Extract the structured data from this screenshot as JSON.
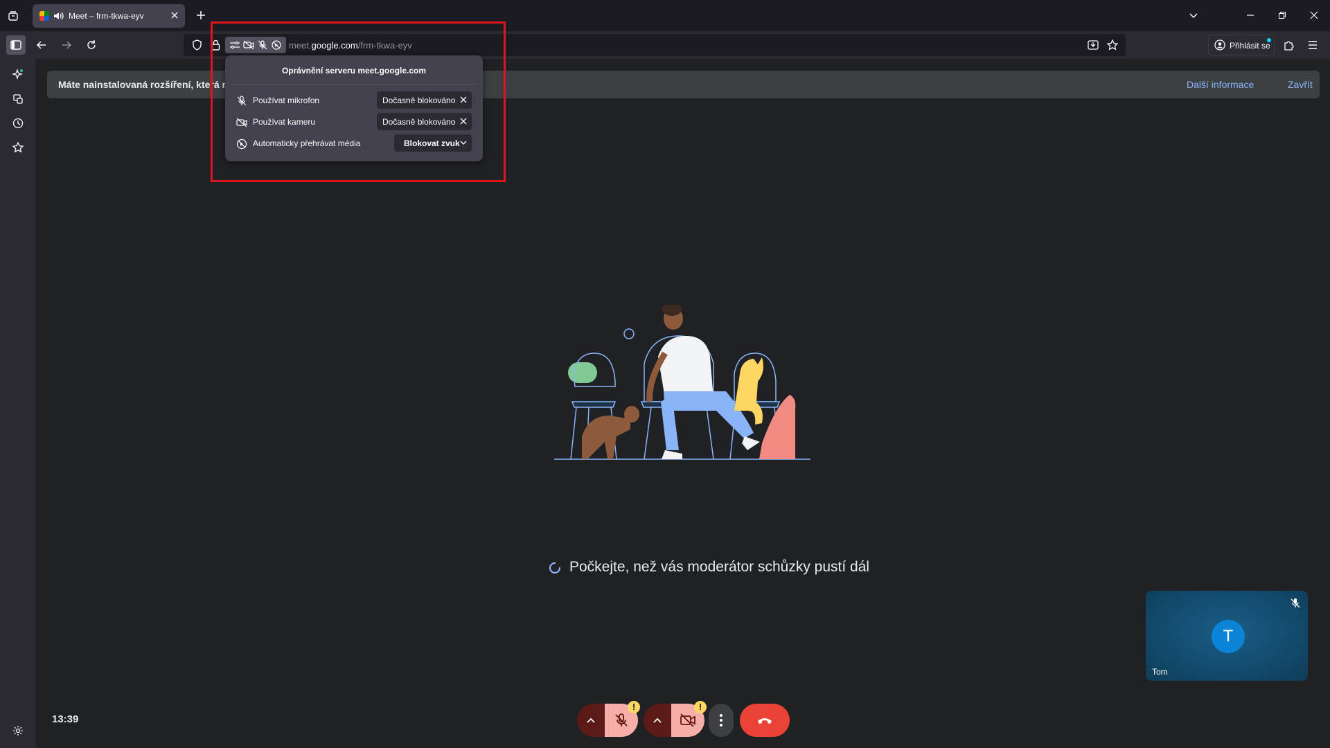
{
  "browser": {
    "tab_title": "Meet – frm-tkwa-eyv",
    "url_host": "meet.google.com",
    "url_prefix": "meet.",
    "url_domain": "google.com",
    "url_path": "/frm-tkwa-eyv",
    "signin_label": "Přihlásit se"
  },
  "infobar": {
    "message": "Máte nainstalovaná rozšíření, která n",
    "more_info": "Další informace",
    "close": "Zavřít"
  },
  "permissions_popup": {
    "title": "Oprávnění serveru meet.google.com",
    "rows": [
      {
        "label": "Používat mikrofon",
        "value": "Dočasně blokováno",
        "icon": "microphone-blocked-icon"
      },
      {
        "label": "Používat kameru",
        "value": "Dočasně blokováno",
        "icon": "camera-blocked-icon"
      },
      {
        "label": "Automaticky přehrávat média",
        "value": "Blokovat zvuk",
        "icon": "autoplay-blocked-icon"
      }
    ]
  },
  "meet": {
    "waiting_text": "Počkejte, než vás moderátor schůzky pustí dál",
    "clock": "13:39",
    "self_initial": "T",
    "self_name": "Tom"
  },
  "colors": {
    "accent_link": "#8ab4f8",
    "hangup": "#ea4335",
    "warning": "#fdd663",
    "highlight_box": "#e0141c"
  }
}
